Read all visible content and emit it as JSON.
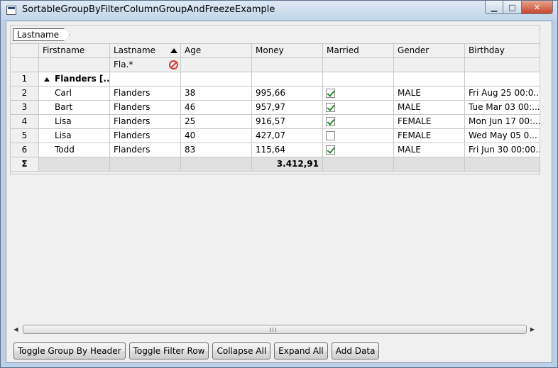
{
  "window": {
    "title": "SortableGroupByFilterColumnGroupAndFreezeExample",
    "minimize_label": "▁",
    "maximize_label": "□",
    "close_label": "✕"
  },
  "groupby": {
    "chip_label": "Lastname"
  },
  "columns": [
    "Firstname",
    "Lastname",
    "Age",
    "Money",
    "Married",
    "Gender",
    "Birthday"
  ],
  "filter": {
    "lastname": "Fla.*"
  },
  "group_row": {
    "row_number": "1",
    "label": "Flanders [..."
  },
  "rows": [
    {
      "n": "2",
      "firstname": "Carl",
      "lastname": "Flanders",
      "age": "38",
      "money": "995,66",
      "married": true,
      "gender": "MALE",
      "birthday": "Fri Aug 25 00:0..."
    },
    {
      "n": "3",
      "firstname": "Bart",
      "lastname": "Flanders",
      "age": "46",
      "money": "957,97",
      "married": true,
      "gender": "MALE",
      "birthday": "Tue Mar 03 00:..."
    },
    {
      "n": "4",
      "firstname": "Lisa",
      "lastname": "Flanders",
      "age": "25",
      "money": "916,57",
      "married": true,
      "gender": "FEMALE",
      "birthday": "Mon Jun 17 00:..."
    },
    {
      "n": "5",
      "firstname": "Lisa",
      "lastname": "Flanders",
      "age": "40",
      "money": "427,07",
      "married": false,
      "gender": "FEMALE",
      "birthday": "Wed May 05 0..."
    },
    {
      "n": "6",
      "firstname": "Todd",
      "lastname": "Flanders",
      "age": "83",
      "money": "115,64",
      "married": true,
      "gender": "MALE",
      "birthday": "Fri Jun 30 00:00..."
    }
  ],
  "summary": {
    "symbol": "Σ",
    "money_total": "3.412,91"
  },
  "buttons": {
    "toggle_group_by_header": "Toggle Group By Header",
    "toggle_filter_row": "Toggle Filter Row",
    "collapse_all": "Collapse All",
    "expand_all": "Expand All",
    "add_data": "Add Data"
  },
  "scroll": {
    "left_arrow": "◀",
    "right_arrow": "▶"
  },
  "colors": {
    "check": "#2a8a2a",
    "clear_filter": "#d23a3a",
    "title_bar": "#c2d5ea"
  }
}
